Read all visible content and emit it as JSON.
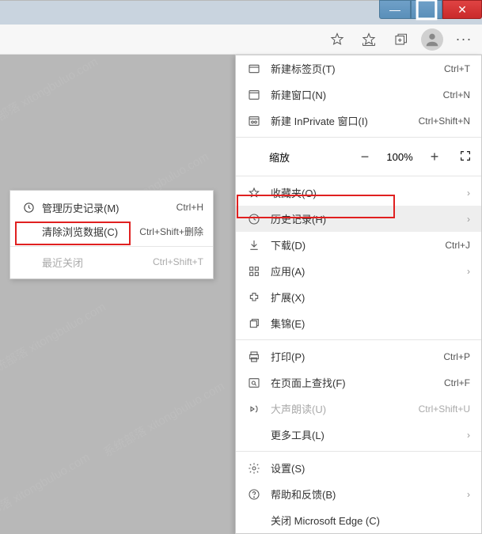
{
  "window": {
    "min": "—",
    "max": "▢",
    "close": "✕"
  },
  "toolbar": {
    "more": "···"
  },
  "zoom": {
    "label": "缩放",
    "minus": "−",
    "value": "100%",
    "plus": "+"
  },
  "menu": {
    "newTab": {
      "label": "新建标签页(T)",
      "shortcut": "Ctrl+T"
    },
    "newWin": {
      "label": "新建窗口(N)",
      "shortcut": "Ctrl+N"
    },
    "newPriv": {
      "label": "新建 InPrivate 窗口(I)",
      "shortcut": "Ctrl+Shift+N"
    },
    "favorites": {
      "label": "收藏夹(O)",
      "chevron": "›"
    },
    "history": {
      "label": "历史记录(H)",
      "chevron": "›"
    },
    "downloads": {
      "label": "下载(D)",
      "shortcut": "Ctrl+J"
    },
    "apps": {
      "label": "应用(A)",
      "chevron": "›"
    },
    "extensions": {
      "label": "扩展(X)"
    },
    "collections": {
      "label": "集锦(E)"
    },
    "print": {
      "label": "打印(P)",
      "shortcut": "Ctrl+P"
    },
    "find": {
      "label": "在页面上查找(F)",
      "shortcut": "Ctrl+F"
    },
    "readAloud": {
      "label": "大声朗读(U)",
      "shortcut": "Ctrl+Shift+U"
    },
    "moreTools": {
      "label": "更多工具(L)",
      "chevron": "›"
    },
    "settings": {
      "label": "设置(S)"
    },
    "help": {
      "label": "帮助和反馈(B)",
      "chevron": "›"
    },
    "closeEdge": {
      "label": "关闭 Microsoft Edge (C)"
    }
  },
  "submenu": {
    "manage": {
      "label": "管理历史记录(M)",
      "shortcut": "Ctrl+H"
    },
    "clear": {
      "label": "清除浏览数据(C)",
      "shortcut": "Ctrl+Shift+删除"
    },
    "recent": {
      "label": "最近关闭",
      "shortcut": "Ctrl+Shift+T"
    }
  },
  "watermarks": [
    "系统部落 xitongbuluo.com",
    "系统部落 xitongbuluo.com",
    "系统部落 xitongbuluo.com",
    "系统部落 xitongbuluo.com",
    "系统部落 xitongbuluo.com",
    "系统部落 xitongbuluo.com"
  ]
}
